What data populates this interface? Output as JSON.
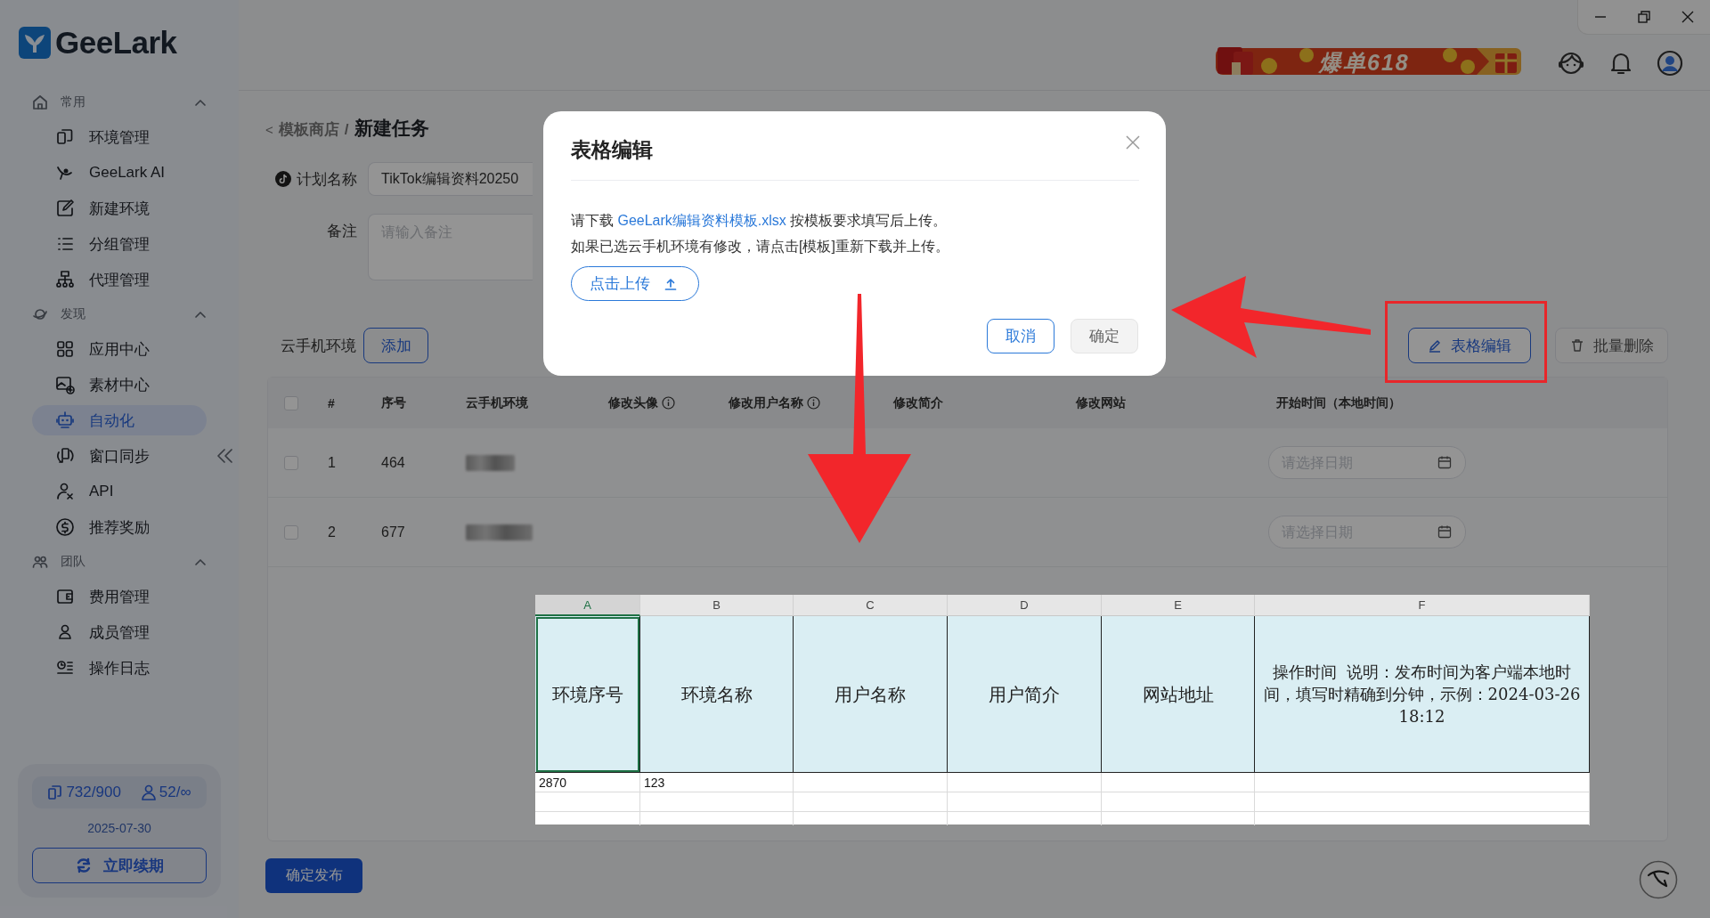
{
  "window": {
    "logo": "GeeLark"
  },
  "sidebar": {
    "sections": [
      {
        "label": "常用",
        "expanded": true,
        "items": [
          {
            "label": "环境管理",
            "selected": false
          },
          {
            "label": "GeeLark AI",
            "selected": false
          },
          {
            "label": "新建环境",
            "selected": false
          },
          {
            "label": "分组管理",
            "selected": false
          },
          {
            "label": "代理管理",
            "selected": false
          }
        ]
      },
      {
        "label": "发现",
        "expanded": true,
        "items": [
          {
            "label": "应用中心",
            "selected": false
          },
          {
            "label": "素材中心",
            "selected": false
          },
          {
            "label": "自动化",
            "selected": true
          },
          {
            "label": "窗口同步",
            "selected": false
          },
          {
            "label": "API",
            "selected": false
          },
          {
            "label": "推荐奖励",
            "selected": false
          }
        ]
      },
      {
        "label": "团队",
        "expanded": true,
        "items": [
          {
            "label": "费用管理",
            "selected": false
          },
          {
            "label": "成员管理",
            "selected": false
          },
          {
            "label": "操作日志",
            "selected": false
          }
        ]
      }
    ],
    "quota": {
      "devices": "732/900",
      "members": "52/∞",
      "expiry": "2025-07-30",
      "renew_button": "立即续期"
    }
  },
  "header": {
    "promo_banner": "爆单618"
  },
  "breadcrumb": {
    "back": "<",
    "parent": "模板商店",
    "separator": "/",
    "current": "新建任务"
  },
  "form": {
    "plan_name": {
      "label": "计划名称",
      "value": "TikTok编辑资料20250"
    },
    "remark": {
      "label": "备注",
      "placeholder": "请输入备注"
    }
  },
  "devices": {
    "label": "云手机环境",
    "add_button": "添加",
    "table_edit_button": "表格编辑",
    "bulk_delete_button": "批量删除",
    "select_all_checked": false,
    "columns": [
      {
        "label": "#",
        "kind": "plain"
      },
      {
        "label": "序号",
        "kind": "plain"
      },
      {
        "label": "云手机环境",
        "kind": "plain"
      },
      {
        "label": "修改头像",
        "kind": "hint"
      },
      {
        "label": "修改用户名称",
        "kind": "hint"
      },
      {
        "label": "修改简介",
        "kind": "plain"
      },
      {
        "label": "修改网站",
        "kind": "plain"
      },
      {
        "label": "开始时间（本地时间）",
        "kind": "plain"
      }
    ],
    "rows": [
      {
        "checked": false,
        "number": "1",
        "serial": "464",
        "start_time_placeholder": "请选择日期"
      },
      {
        "checked": false,
        "number": "2",
        "serial": "677",
        "start_time_placeholder": "请选择日期"
      }
    ]
  },
  "submit_button": "确定发布",
  "dialog": {
    "title": "表格编辑",
    "line_1": {
      "before": "请下载",
      "link": "GeeLark编辑资料模板.xlsx",
      "after": "按模板要求填写后上传。"
    },
    "line_2": "如果已选云手机环境有修改，请点击[模板]重新下载并上传。",
    "upload_button": "点击上传",
    "cancel_button": "取消",
    "confirm_button": {
      "label": "确定",
      "disabled": true
    }
  },
  "spreadsheet": {
    "columns": [
      {
        "letter": "A",
        "selected": true
      },
      {
        "letter": "B",
        "selected": false
      },
      {
        "letter": "C",
        "selected": false
      },
      {
        "letter": "D",
        "selected": false
      },
      {
        "letter": "E",
        "selected": false
      },
      {
        "letter": "F",
        "selected": false
      }
    ],
    "header_cells": [
      "环境序号",
      "环境名称",
      "用户名称",
      "用户简介",
      "网站地址",
      "操作时间  说明：发布时间为客户端本地时间，填写时精确到分钟，示例：2024-03-26 18:12"
    ],
    "rows": [
      {
        "cells": [
          "2870",
          "123"
        ]
      }
    ]
  }
}
